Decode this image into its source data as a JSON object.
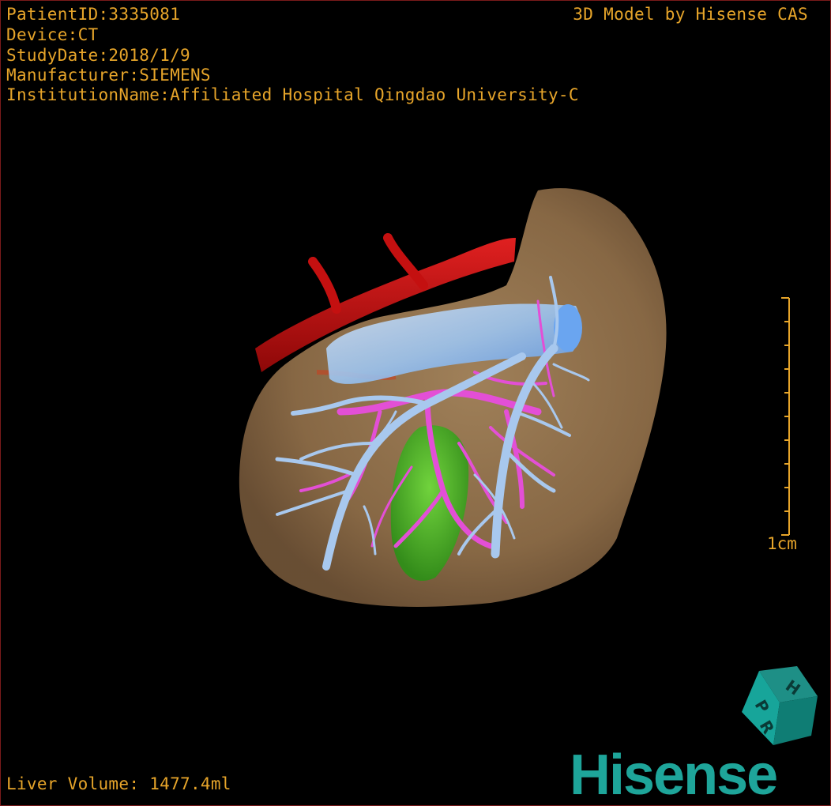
{
  "header": {
    "patient_id": "PatientID:3335081",
    "device": "Device:CT",
    "study_date": "StudyDate:2018/1/9",
    "manufacturer": "Manufacturer:SIEMENS",
    "institution": "InstitutionName:Affiliated Hospital Qingdao University-C",
    "model_credit": "3D Model by Hisense CAS"
  },
  "footer": {
    "liver_volume": "Liver Volume: 1477.4ml"
  },
  "scale": {
    "label": "1cm"
  },
  "orientation_cube": {
    "letters": [
      "H",
      "P",
      "R"
    ]
  },
  "logo": {
    "text": "Hisense"
  },
  "colors": {
    "text": "#e7a52a",
    "liver": "#9a7a55",
    "artery": "#c41010",
    "portal_vein": "#e34fd6",
    "hepatic_vein": "#a8c8ee",
    "ivc": "#6aa5f0",
    "gallbladder": "#4cc02a",
    "logo_teal": "#1ea59a"
  }
}
